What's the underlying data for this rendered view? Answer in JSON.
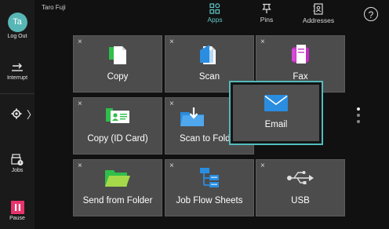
{
  "user": {
    "initials": "Ta",
    "name": "Taro Fuji"
  },
  "rail": {
    "logout": "Log Out",
    "interrupt": "Interrupt",
    "jobs": "Jobs",
    "pause": "Pause",
    "settings_chevron": "〉"
  },
  "top_tabs": [
    {
      "label": "Apps",
      "icon": "apps-grid-icon",
      "active": true
    },
    {
      "label": "Pins",
      "icon": "pin-icon",
      "active": false
    },
    {
      "label": "Addresses",
      "icon": "address-book-icon",
      "active": false
    }
  ],
  "help": "?",
  "tiles": [
    {
      "label": "Copy",
      "icon": "copy-icon"
    },
    {
      "label": "Scan",
      "icon": "scan-icon"
    },
    {
      "label": "Fax",
      "icon": "fax-icon"
    },
    {
      "label": "Copy (ID Card)",
      "icon": "id-card-icon"
    },
    {
      "label": "Scan to Fold",
      "icon": "scan-to-folder-icon"
    },
    {
      "label": "Email",
      "icon": "email-icon"
    },
    {
      "label": "Send from Folder",
      "icon": "folder-icon"
    },
    {
      "label": "Job Flow Sheets",
      "icon": "job-flow-icon"
    },
    {
      "label": "USB",
      "icon": "usb-icon"
    }
  ],
  "remove_mark": "×",
  "colors": {
    "accent": "#53bcbc",
    "pause": "#e8336b",
    "copy_green": "#2fbf4a",
    "scan_blue": "#2a8de0",
    "fax_magenta": "#c22ec4",
    "folder_green": "#8fcf3a"
  },
  "pagination": {
    "pages": 3,
    "current": 1
  }
}
